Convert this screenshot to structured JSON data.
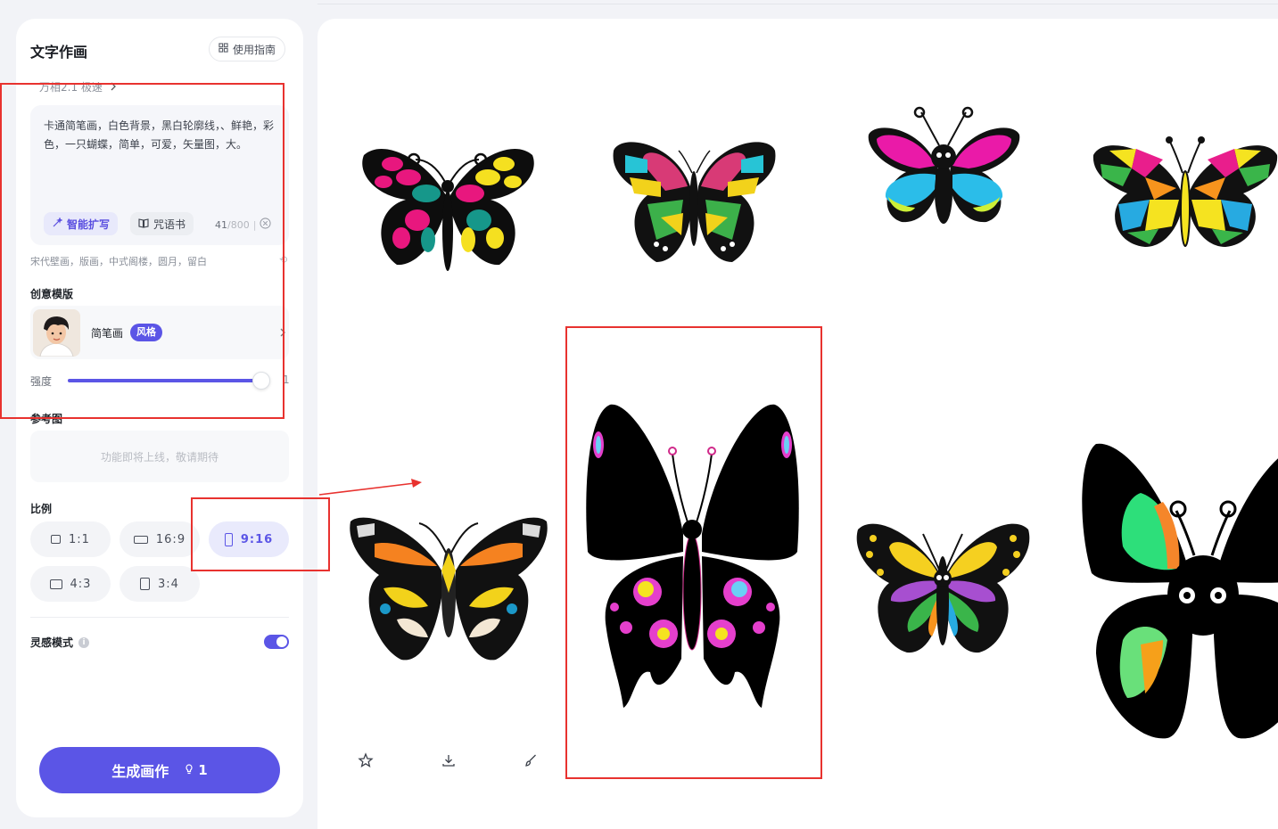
{
  "panel": {
    "title": "文字作画",
    "guide_label": "使用指南",
    "model_label": "万相2.1 极速",
    "prompt_text": "卡通简笔画，白色背景，黑白轮廓线，、鲜艳，彩色，一只蝴蝶，简单，可爱，矢量图，大。",
    "expand_label": "智能扩写",
    "spellbook_label": "咒语书",
    "char_count": "41",
    "char_max": "/800",
    "char_sep": "|",
    "suggest_tags": "宋代壁画，版画，中式阁楼，圆月，留白",
    "suggest_end": "⟲",
    "template_section": "创意模版",
    "template_name": "简笔画",
    "template_badge": "风格",
    "strength_label": "强度",
    "strength_value": "1",
    "strength_fraction": 0.96,
    "reference_section": "参考图",
    "reference_placeholder": "功能即将上线，敬请期待",
    "ratio_section": "比例",
    "ratios": [
      {
        "label": "1:1",
        "active": false
      },
      {
        "label": "16:9",
        "active": false
      },
      {
        "label": "9:16",
        "active": true
      },
      {
        "label": "4:3",
        "active": false
      },
      {
        "label": "3:4",
        "active": false
      }
    ],
    "inspire_label": "灵感模式",
    "info_mark": "i",
    "inspire_on": true,
    "generate_label": "生成画作",
    "generate_cost": "1"
  },
  "colors": {
    "accent": "#5b55e6",
    "annotation": "#e8322f"
  },
  "gallery": {
    "items": [
      {
        "name": "butterfly-1",
        "description": "black butterfly with pink, teal and yellow spots"
      },
      {
        "name": "butterfly-2",
        "description": "butterfly with pink, cyan, green and yellow panels"
      },
      {
        "name": "butterfly-3",
        "description": "pink, cyan and lime butterfly"
      },
      {
        "name": "butterfly-4",
        "description": "stained-glass rainbow butterfly"
      },
      {
        "name": "butterfly-5",
        "description": "black and orange patterned butterfly"
      },
      {
        "name": "butterfly-6",
        "description": "black swallowtail with pink spots"
      },
      {
        "name": "butterfly-7",
        "description": "butterfly with yellow, purple, green wings"
      },
      {
        "name": "butterfly-8",
        "description": "big-eyed black butterfly with green and orange wings"
      }
    ],
    "actions": [
      "star-icon",
      "download-icon",
      "brush-icon"
    ]
  }
}
